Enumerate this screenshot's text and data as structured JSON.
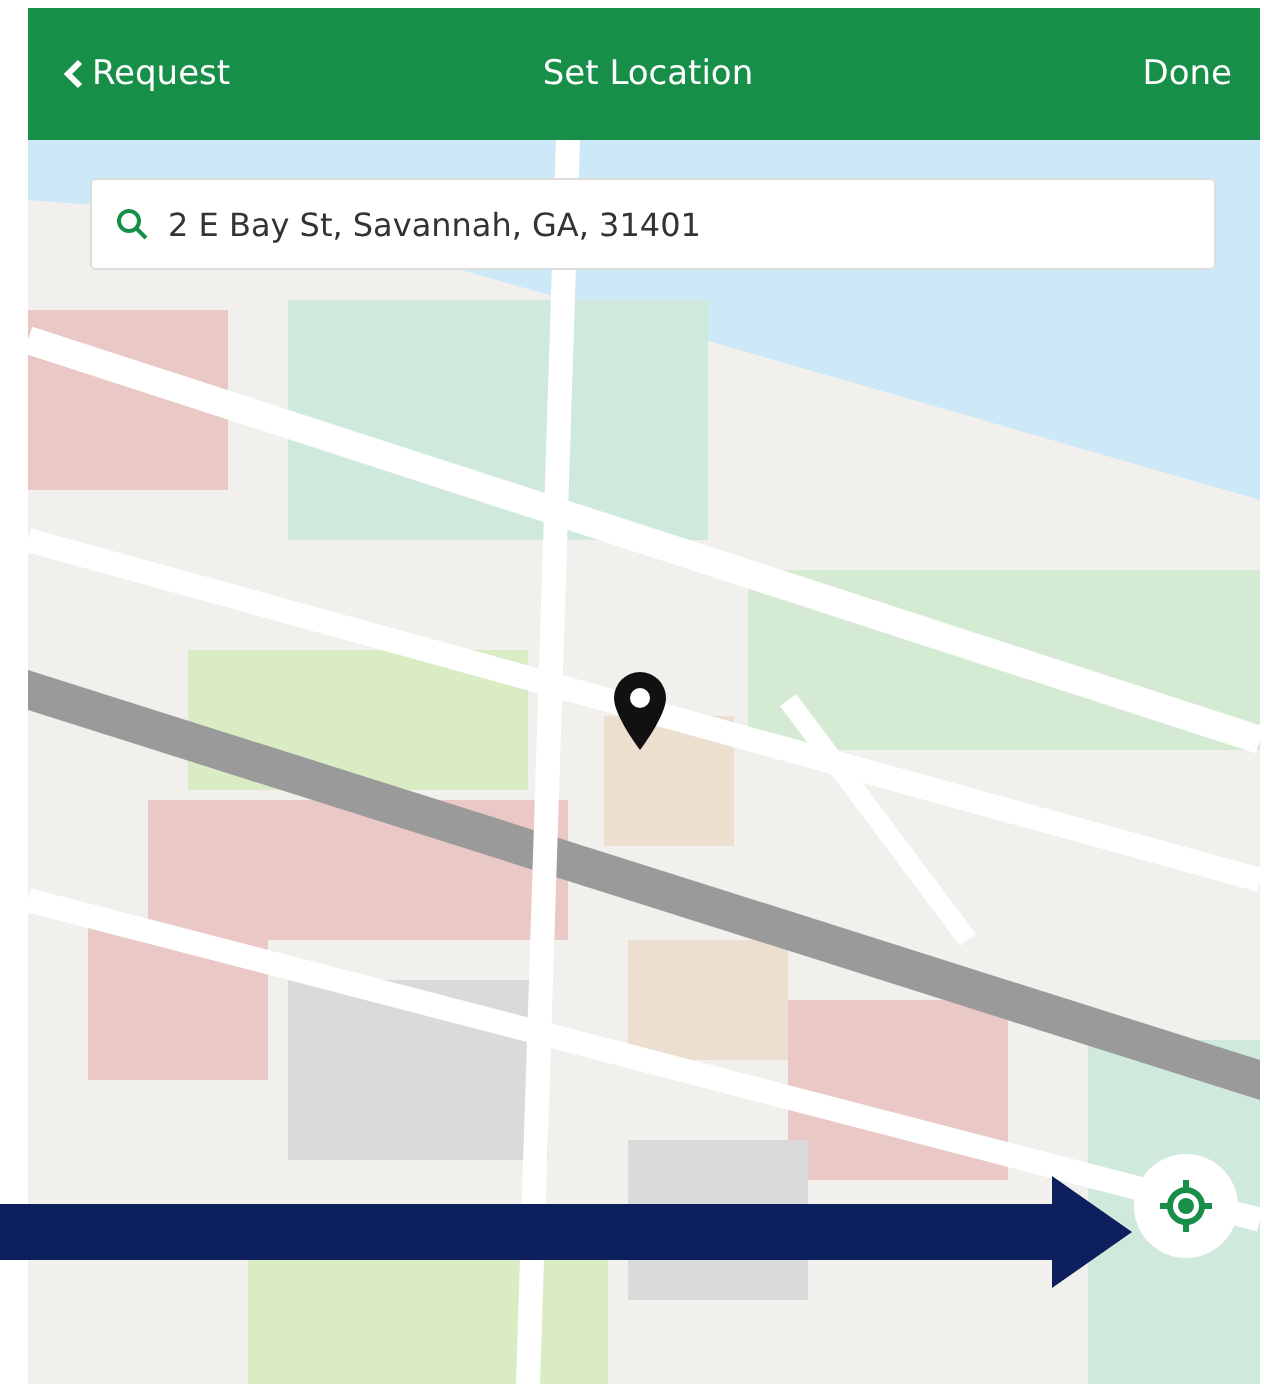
{
  "header": {
    "back_label": "Request",
    "title": "Set Location",
    "done_label": "Done"
  },
  "search": {
    "value": "2 E Bay St, Savannah, GA, 31401"
  }
}
